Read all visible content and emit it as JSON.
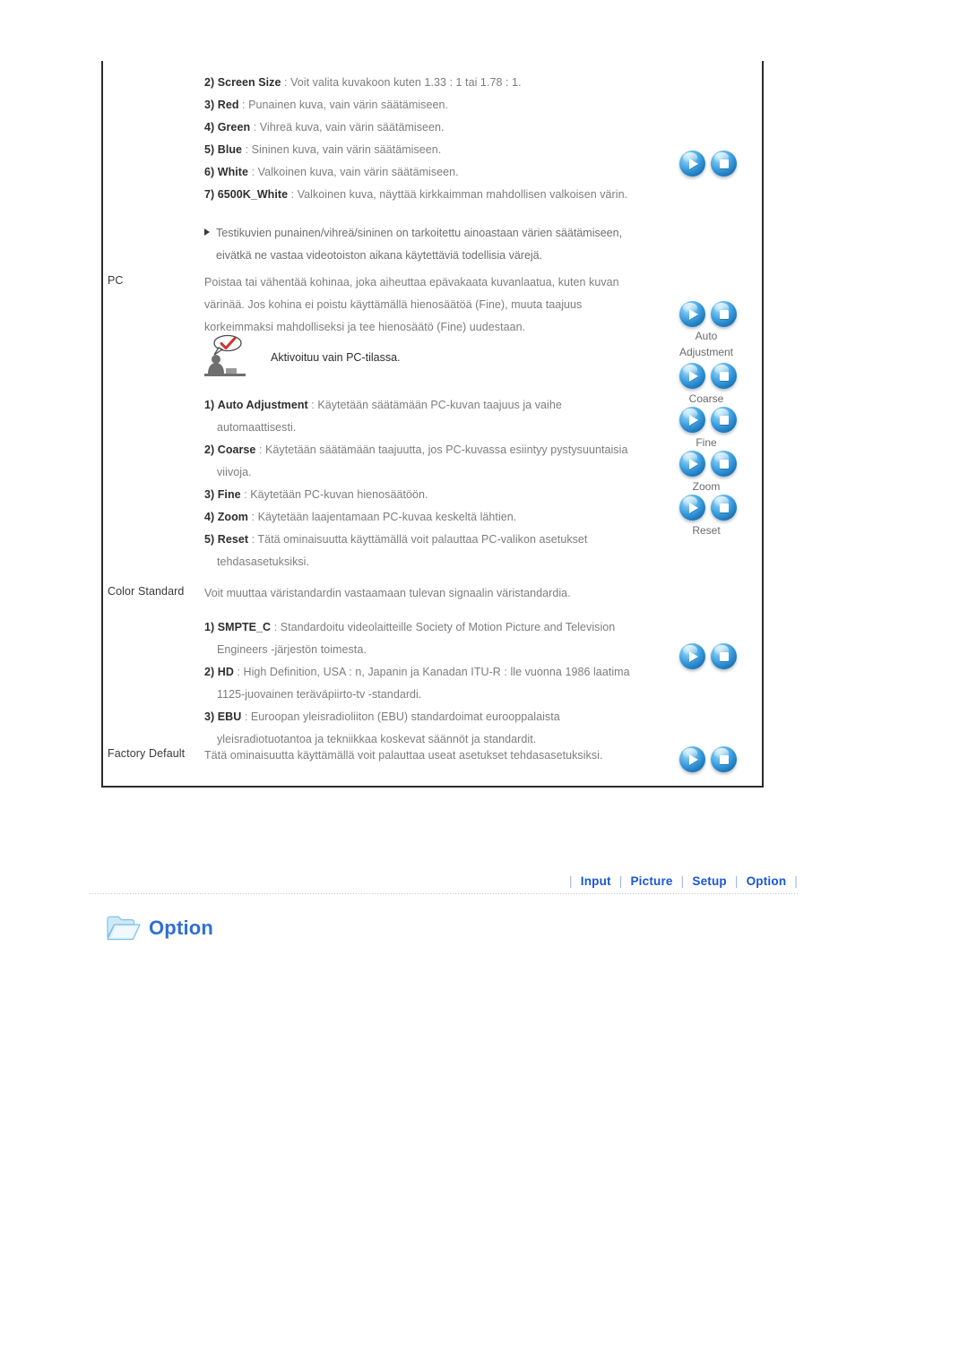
{
  "manual": {
    "picture_items": [
      {
        "num": "2)",
        "key": "Screen Size",
        "sep": ":",
        "desc": "Voit valita kuvakoon kuten 1.33 : 1 tai 1.78 : 1."
      },
      {
        "num": "3)",
        "key": "Red",
        "sep": ":",
        "desc": "Punainen kuva, vain värin säätämiseen."
      },
      {
        "num": "4)",
        "key": "Green",
        "sep": ":",
        "desc": "Vihreä kuva, vain värin säätämiseen."
      },
      {
        "num": "5)",
        "key": "Blue",
        "sep": ":",
        "desc": "Sininen kuva, vain värin säätämiseen."
      },
      {
        "num": "6)",
        "key": "White",
        "sep": ":",
        "desc": "Valkoinen kuva, vain värin säätämiseen."
      },
      {
        "num": "7)",
        "key": "6500K_White",
        "sep": ":",
        "desc": "Valkoinen kuva, näyttää kirkkaimman mahdollisen valkoisen värin."
      }
    ],
    "note_bullet": {
      "line1": "Testikuvien punainen/vihreä/sininen on tarkoitettu ainoastaan värien säätämiseen,",
      "line2": "eivätkä ne vastaa videotoiston aikana käytettäviä todellisia värejä."
    },
    "pc_section": {
      "term": "PC",
      "desc_line1": "Poistaa tai vähentää kohinaa, joka aiheuttaa epävakaata kuvanlaatua, kuten kuvan",
      "desc_line2": "värinää. Jos kohina ei poistu käyttämällä hienosäätöä (Fine), muuta taajuus",
      "desc_line3": "korkeimmaksi mahdolliseksi ja tee hienosäätö (Fine) uudestaan.",
      "tip": "Aktivoituu vain PC-tilassa.",
      "items": [
        {
          "num": "1)",
          "key": "Auto Adjustment",
          "sep": ":",
          "desc": "Käytetään säätämään PC-kuvan taajuus ja vaihe",
          "cont": "automaattisesti."
        },
        {
          "num": "2)",
          "key": "Coarse",
          "sep": ":",
          "desc": "Käytetään säätämään taajuutta, jos PC-kuvassa esiintyy pystysuuntaisia",
          "cont": "viivoja."
        },
        {
          "num": "3)",
          "key": "Fine",
          "sep": ":",
          "desc": "Käytetään PC-kuvan hienosäätöön.",
          "cont": ""
        },
        {
          "num": "4)",
          "key": "Zoom",
          "sep": ":",
          "desc": "Käytetään laajentamaan PC-kuvaa keskeltä lähtien.",
          "cont": ""
        },
        {
          "num": "5)",
          "key": "Reset",
          "sep": ":",
          "desc": "Tätä ominaisuutta käyttämällä voit palauttaa PC-valikon asetukset",
          "cont": "tehdasasetuksiksi."
        }
      ]
    },
    "color_standard_section": {
      "term": "Color Standard",
      "desc": "Voit muuttaa väristandardin vastaamaan tulevan signaalin väristandardia.",
      "items": [
        {
          "num": "1)",
          "key": "SMPTE_C",
          "sep": ":",
          "desc": "Standardoitu videolaitteille Society of Motion Picture and Television",
          "cont": "Engineers -järjestön toimesta."
        },
        {
          "num": "2)",
          "key": "HD",
          "sep": ":",
          "desc": "High Definition, USA : n, Japanin ja Kanadan ITU-R : lle vuonna 1986 laatima",
          "cont": "1125-juovainen teräväpiirto-tv -standardi."
        },
        {
          "num": "3)",
          "key": "EBU",
          "sep": ":",
          "desc": "Euroopan yleisradioliiton (EBU) standardoimat eurooppalaista",
          "cont": "yleisradiotuotantoa ja tekniikkaa koskevat säännöt ja standardit."
        }
      ]
    },
    "factory_default_section": {
      "term": "Factory Default",
      "desc": "Tätä ominaisuutta käyttämällä voit palauttaa useat asetukset tehdasasetuksiksi."
    },
    "remote_labels": {
      "auto_adjustment_line1": "Auto",
      "auto_adjustment_line2": "Adjustment",
      "coarse": "Coarse",
      "fine": "Fine",
      "zoom": "Zoom",
      "reset": "Reset"
    }
  },
  "bottom_nav": {
    "pipe": "|",
    "items": [
      {
        "label": "Input"
      },
      {
        "label": "Picture"
      },
      {
        "label": "Setup"
      },
      {
        "label": "Option"
      }
    ]
  },
  "section_heading": {
    "title": "Option",
    "icon": "folder-icon"
  },
  "colors": {
    "link_blue": "#1a56d6",
    "heading_blue": "#2f6fd0",
    "button_blue": "#2f93d8",
    "body_text": "#7d7d7d",
    "key_text": "#2e2e2e",
    "border": "#2b2b2b"
  }
}
